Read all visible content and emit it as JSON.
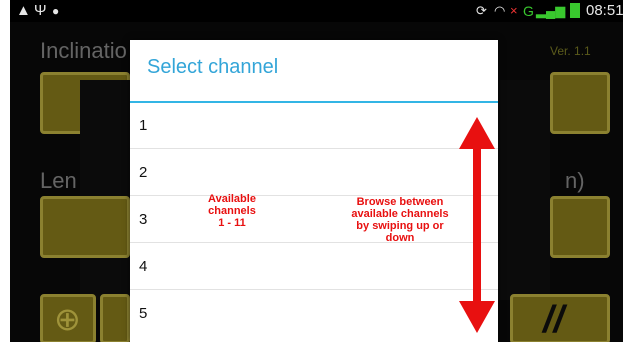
{
  "status_bar": {
    "left_icons": [
      "warning-icon",
      "usb-icon",
      "android-icon"
    ],
    "network_label": "G",
    "time": "08:51"
  },
  "app": {
    "title": "Inclinatio",
    "version": "Ver. 1.1",
    "left_label": "Len",
    "right_label": "n)"
  },
  "dialog": {
    "title": "Select channel",
    "items": [
      "1",
      "2",
      "3",
      "4",
      "5"
    ]
  },
  "annotations": {
    "left_note_lines": [
      "Available",
      "channels",
      "1 - 11"
    ],
    "right_note_lines": [
      "Browse between",
      "available channels",
      "by swiping up or",
      "down"
    ]
  },
  "colors": {
    "accent_blue": "#33b5e5",
    "annotation_red": "#e81010",
    "tile_yellow": "#9a8a1f"
  }
}
